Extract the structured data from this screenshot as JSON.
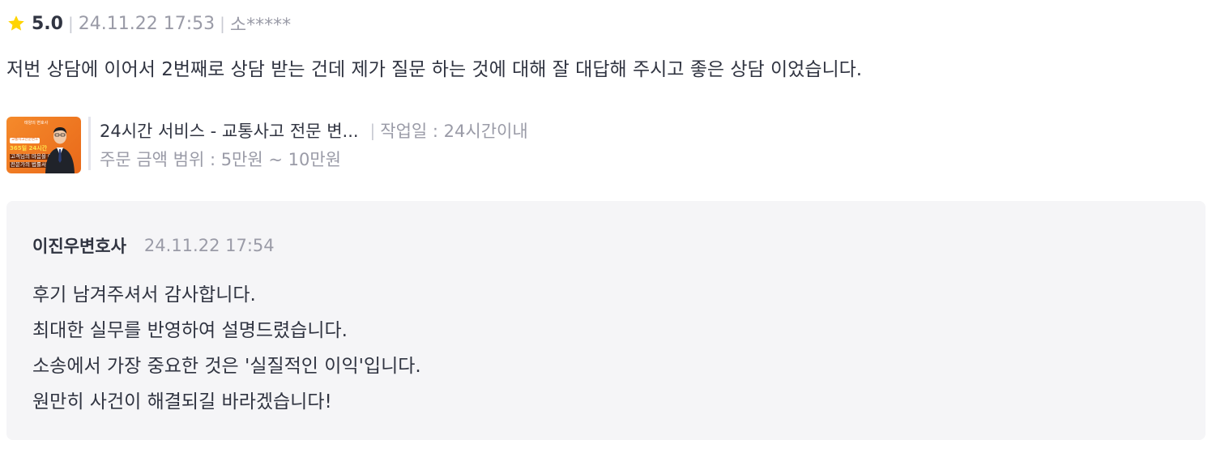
{
  "review": {
    "rating": "5.0",
    "date": "24.11.22 17:53",
    "author": "소*****",
    "separator": "|",
    "body": "저번 상담에 이어서  2번째로 상담 받는 건데 제가 질문 하는 것에 대해 잘 대답해 주시고 좋은 상담 이었습니다."
  },
  "service": {
    "title": "24시간 서비스 - 교통사고 전문 변...",
    "work_period": "작업일 : 24시간이내",
    "price_range": "주문 금액 범위 : 5만원 ~ 10만원",
    "thumbnail": {
      "top_label": "태양의 변호사",
      "pill": "교통사고전문변호",
      "highlight": "365일 24시간",
      "line1": "고객님의 마음을 아는",
      "line2": "전문가의 법률서비스"
    }
  },
  "reply": {
    "author": "이진우변호사",
    "date": "24.11.22 17:54",
    "lines": [
      "후기 남겨주셔서 감사합니다.",
      "최대한 실무를 반영하여 설명드렸습니다.",
      "소송에서 가장 중요한 것은 '실질적인 이익'입니다.",
      "원만히 사건이 해결되길 바라겠습니다!"
    ]
  },
  "colors": {
    "star": "#ffd400",
    "text": "#303441",
    "muted": "#9a9ba7",
    "reply_bg": "#f5f5f7",
    "thumbnail_orange": "#f58a2b"
  },
  "icons": {
    "rating": "star-icon"
  }
}
